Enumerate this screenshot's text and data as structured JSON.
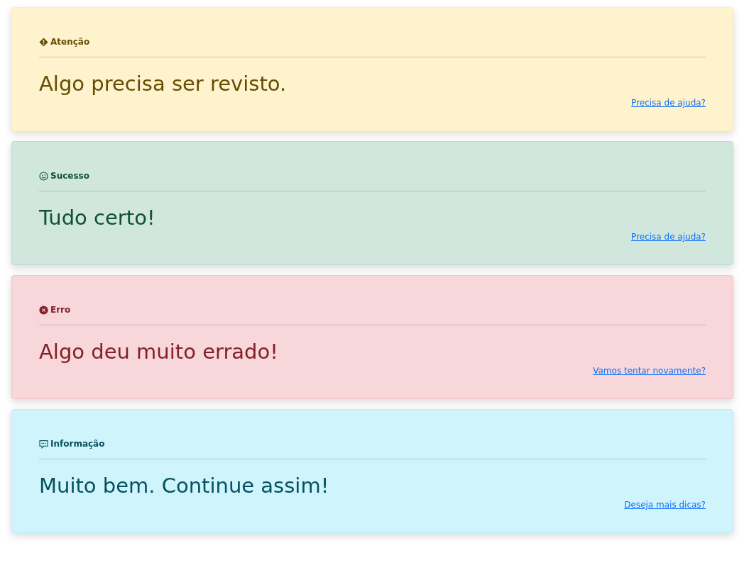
{
  "alerts": [
    {
      "kind": "warning",
      "title": "Atenção",
      "message": "Algo precisa ser revisto.",
      "link": "Precisa de ajuda?"
    },
    {
      "kind": "success",
      "title": "Sucesso",
      "message": "Tudo certo!",
      "link": "Precisa de ajuda?"
    },
    {
      "kind": "danger",
      "title": "Erro",
      "message": "Algo deu muito errado!",
      "link": "Vamos tentar novamente?"
    },
    {
      "kind": "info",
      "title": "Informação",
      "message": "Muito bem. Continue assim!",
      "link": "Deseja mais dicas?"
    }
  ]
}
